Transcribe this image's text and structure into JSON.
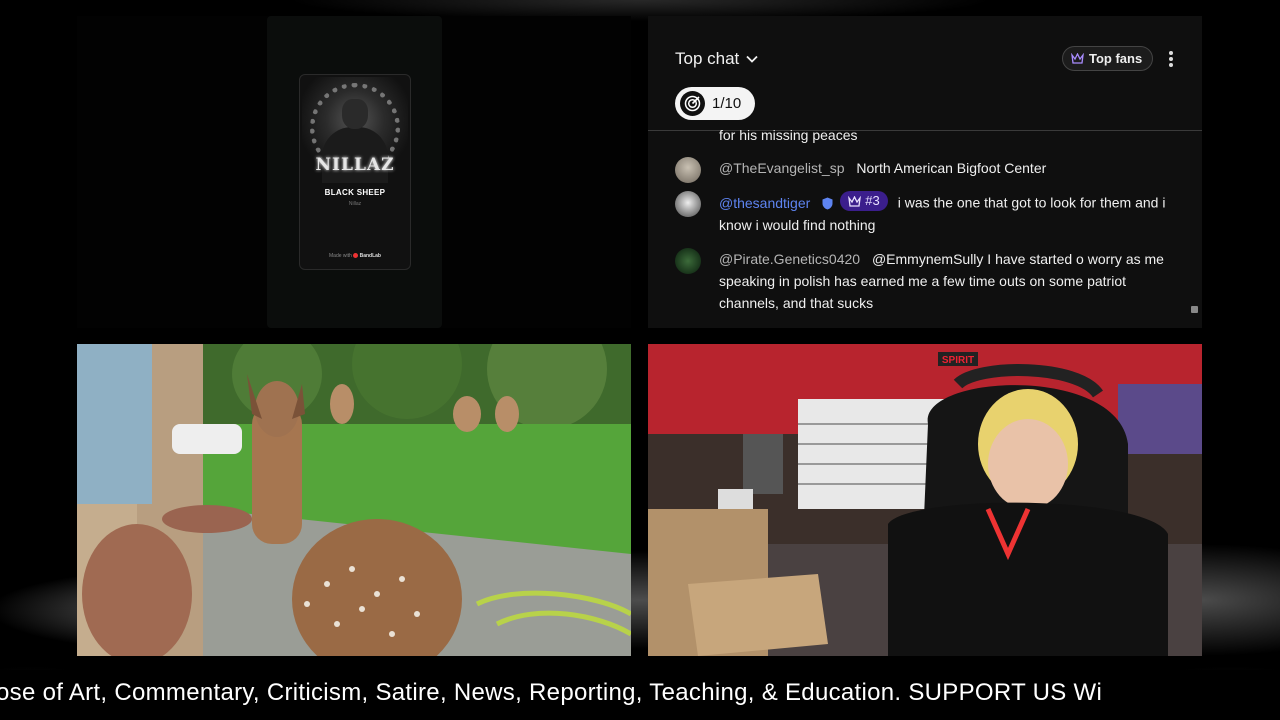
{
  "music_card": {
    "album_logo": "NILLAZ",
    "song_title": "BLACK SHEEP",
    "artist": "Nillaz",
    "made_with": "Made with",
    "brand": "BandLab"
  },
  "chat": {
    "mode_label": "Top chat",
    "top_fans_label": "Top fans",
    "goal_progress": "1/10",
    "messages": [
      {
        "author": "",
        "text": "for his missing peaces"
      },
      {
        "author": "@TheEvangelist_sp",
        "text": "North American Bigfoot Center"
      },
      {
        "author": "@thesandtiger",
        "rank": "#3",
        "text": "i was the one that got to look for them and i know i would find nothing"
      },
      {
        "author": "@Pirate.Genetics0420",
        "text": "@EmmynemSully I have started o worry as me speaking in polish has earned me a few time outs on some patriot channels, and that sucks"
      }
    ]
  },
  "garage_sign": "SPIRIT",
  "ticker": {
    "text": "ose of Art, Commentary, Criticism, Satire, News, Reporting, Teaching, & Education. SUPPORT US Wi"
  },
  "colors": {
    "member_name": "#5e84f1",
    "rank_badge_bg": "#3b1e8c",
    "chat_bg": "#0f0f0f"
  }
}
